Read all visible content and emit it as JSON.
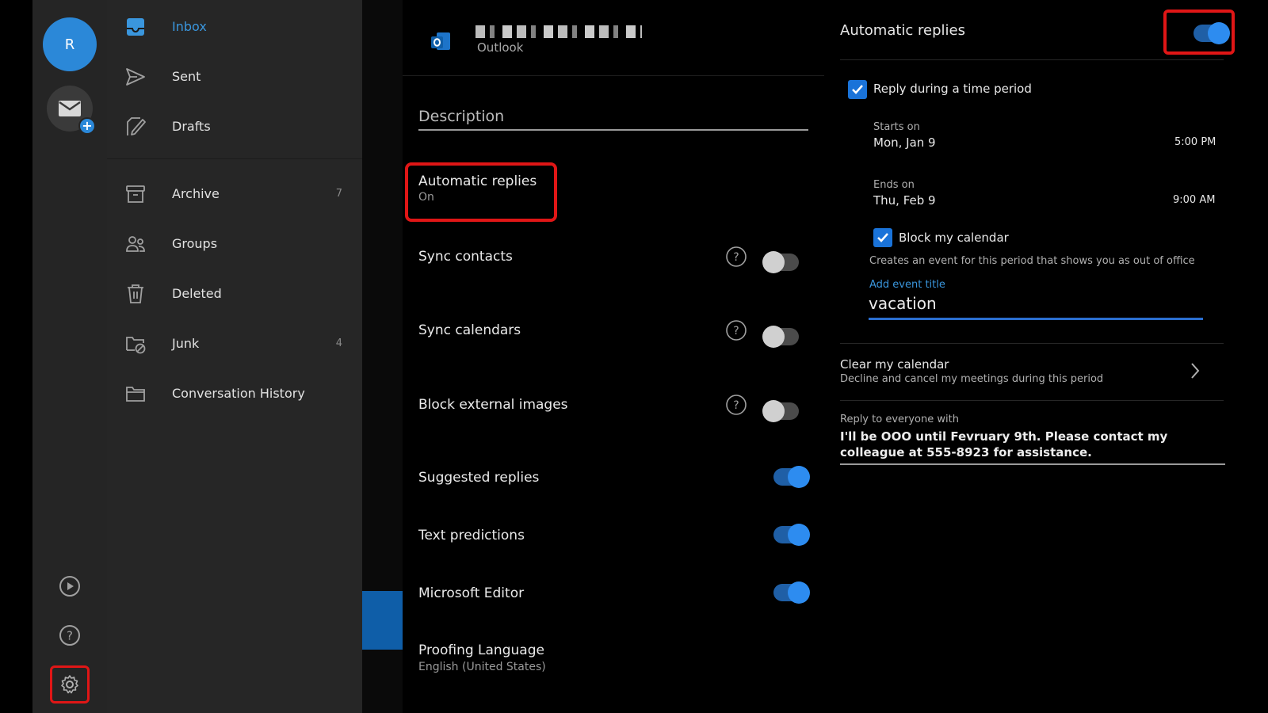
{
  "rail": {
    "avatar_initial": "R"
  },
  "folders": [
    {
      "label": "Inbox",
      "count": "",
      "icon": "inbox-icon"
    },
    {
      "label": "Sent",
      "count": "",
      "icon": "sent-icon"
    },
    {
      "label": "Drafts",
      "count": "",
      "icon": "drafts-icon"
    },
    {
      "label": "Archive",
      "count": "7",
      "icon": "archive-icon"
    },
    {
      "label": "Groups",
      "count": "",
      "icon": "groups-icon"
    },
    {
      "label": "Deleted",
      "count": "",
      "icon": "trash-icon"
    },
    {
      "label": "Junk",
      "count": "4",
      "icon": "junk-icon"
    },
    {
      "label": "Conversation History",
      "count": "",
      "icon": "folder-icon"
    }
  ],
  "account": {
    "type_label": "Outlook"
  },
  "settings": {
    "description_label": "Description",
    "automatic_replies": {
      "label": "Automatic replies",
      "status": "On"
    },
    "sync_contacts": {
      "label": "Sync contacts",
      "enabled": false
    },
    "sync_calendars": {
      "label": "Sync calendars",
      "enabled": false
    },
    "block_external_images": {
      "label": "Block external images",
      "enabled": false
    },
    "suggested_replies": {
      "label": "Suggested replies",
      "enabled": true
    },
    "text_predictions": {
      "label": "Text predictions",
      "enabled": true
    },
    "microsoft_editor": {
      "label": "Microsoft Editor",
      "enabled": true
    },
    "proofing_language": {
      "label": "Proofing Language",
      "value": "English (United States)"
    }
  },
  "panel": {
    "title": "Automatic replies",
    "enabled": true,
    "reply_period_label": "Reply during a time period",
    "reply_period_checked": true,
    "starts_label": "Starts on",
    "starts_date": "Mon, Jan 9",
    "starts_time": "5:00 PM",
    "ends_label": "Ends on",
    "ends_date": "Thu, Feb 9",
    "ends_time": "9:00 AM",
    "block_calendar_label": "Block my calendar",
    "block_calendar_checked": true,
    "block_calendar_desc": "Creates an event for this period that shows you as out of office",
    "add_event_title_label": "Add event title",
    "event_title_value": "vacation",
    "clear_calendar_label": "Clear my calendar",
    "clear_calendar_desc": "Decline and cancel my meetings during this period",
    "reply_everyone_label": "Reply to everyone with",
    "reply_message": "I'll be OOO until Fevruary 9th. Please contact my colleague at 555-8923 for assistance."
  },
  "colors": {
    "accent": "#2d8cf0",
    "highlight": "#e01616",
    "link": "#3a96dd"
  }
}
